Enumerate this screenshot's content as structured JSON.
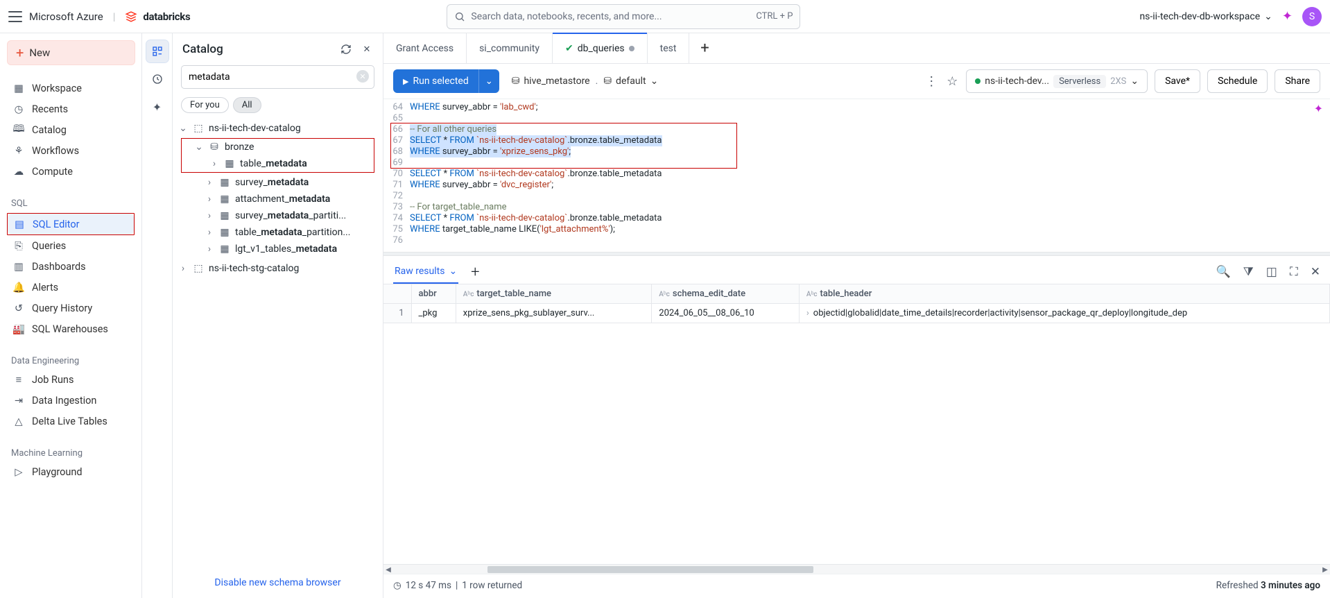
{
  "header": {
    "brand_host": "Microsoft Azure",
    "brand_product": "databricks",
    "search_placeholder": "Search data, notebooks, recents, and more...",
    "search_shortcut": "CTRL + P",
    "workspace_name": "ns-ii-tech-dev-db-workspace",
    "avatar_initial": "S"
  },
  "leftnav": {
    "new_label": "New",
    "items_top": [
      "Workspace",
      "Recents",
      "Catalog",
      "Workflows",
      "Compute"
    ],
    "section_sql": "SQL",
    "items_sql": [
      "SQL Editor",
      "Queries",
      "Dashboards",
      "Alerts",
      "Query History",
      "SQL Warehouses"
    ],
    "section_de": "Data Engineering",
    "items_de": [
      "Job Runs",
      "Data Ingestion",
      "Delta Live Tables"
    ],
    "section_ml": "Machine Learning",
    "items_ml": [
      "Playground"
    ]
  },
  "catalog": {
    "title": "Catalog",
    "search_value": "metadata",
    "pill_foryou": "For you",
    "pill_all": "All",
    "root": "ns-ii-tech-dev-catalog",
    "schema": "bronze",
    "tables": [
      {
        "name": "table_",
        "bold": "metadata"
      },
      {
        "name": "survey_",
        "bold": "metadata"
      },
      {
        "name": "attachment_",
        "bold": "metadata"
      },
      {
        "name": "survey_",
        "bold": "metadata",
        "suffix": "_partiti..."
      },
      {
        "name": "table_",
        "bold": "metadata",
        "suffix": "_partition..."
      },
      {
        "name": "lgt_v1_tables_",
        "bold": "metadata"
      }
    ],
    "other_root": "ns-ii-tech-stg-catalog",
    "footer_link": "Disable new schema browser"
  },
  "tabs": [
    {
      "label": "Grant Access"
    },
    {
      "label": "si_community"
    },
    {
      "label": "db_queries",
      "active": true,
      "status": "ok",
      "dirty": true
    },
    {
      "label": "test"
    }
  ],
  "toolbar": {
    "run_label": "Run selected",
    "metastore": "hive_metastore",
    "default": "default",
    "compute_name": "ns-ii-tech-dev...",
    "compute_type": "Serverless",
    "compute_size": "2XS",
    "save_label": "Save*",
    "schedule_label": "Schedule",
    "share_label": "Share"
  },
  "code": {
    "lines": [
      {
        "n": 64,
        "html": "<span class='kw'>WHERE</span> survey_abbr = <span class='str'>'lab_cwd'</span>;"
      },
      {
        "n": 65,
        "html": ""
      },
      {
        "n": 66,
        "html": "<span class='cmt'>-- For all other queries</span>",
        "sel": true
      },
      {
        "n": 67,
        "html": "<span class='kw'>SELECT</span> * <span class='kw'>FROM</span> <span class='str'>`ns-ii-tech-dev-catalog`</span>.bronze.table_metadata",
        "sel": true
      },
      {
        "n": 68,
        "html": "<span class='kw'>WHERE</span> survey_abbr = <span class='str'>'xprize_sens_pkg'</span>;",
        "sel": true
      },
      {
        "n": 69,
        "html": ""
      },
      {
        "n": 70,
        "html": "<span class='kw'>SELECT</span> * <span class='kw'>FROM</span> <span class='str'>`ns-ii-tech-dev-catalog`</span>.bronze.table_metadata"
      },
      {
        "n": 71,
        "html": "<span class='kw'>WHERE</span> survey_abbr = <span class='str'>'dvc_register'</span>;"
      },
      {
        "n": 72,
        "html": ""
      },
      {
        "n": 73,
        "html": "<span class='cmt'>-- For target_table_name</span>"
      },
      {
        "n": 74,
        "html": "<span class='kw'>SELECT</span> * <span class='kw'>FROM</span> <span class='str'>`ns-ii-tech-dev-catalog`</span>.bronze.table_metadata"
      },
      {
        "n": 75,
        "html": "<span class='kw'>WHERE</span> target_table_name LIKE(<span class='str'>'lgt_attachment%'</span>);"
      },
      {
        "n": 76,
        "html": ""
      }
    ]
  },
  "results": {
    "tab_label": "Raw results",
    "columns": [
      "abbr",
      "target_table_name",
      "schema_edit_date",
      "table_header"
    ],
    "row_number": "1",
    "row": [
      "_pkg",
      "xprize_sens_pkg_sublayer_surv...",
      "2024_06_05__08_06_10",
      "objectid|globalid|date_time_details|recorder|activity|sensor_package_qr_deploy|longitude_dep"
    ]
  },
  "status": {
    "timing": "12 s 47 ms",
    "rowcount": "1 row returned",
    "refreshed_prefix": "Refreshed ",
    "refreshed_value": "3 minutes ago"
  }
}
